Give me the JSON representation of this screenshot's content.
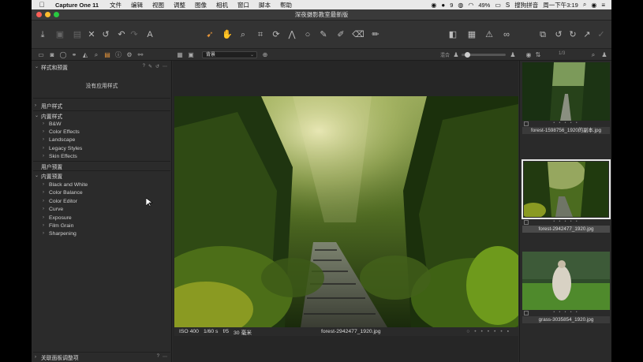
{
  "menubar": {
    "app_name": "Capture One 11",
    "items": [
      "文件",
      "编辑",
      "视图",
      "调整",
      "图像",
      "相机",
      "窗口",
      "脚本",
      "帮助"
    ],
    "status": {
      "notif_count": "9",
      "battery": "49%",
      "input_method": "搜狗拼音",
      "clock": "周一下午3:19"
    }
  },
  "window": {
    "title": "深夜摄影教室最新版"
  },
  "subbar": {
    "layer": "背景",
    "mix_label": "混合",
    "counter": "1/3"
  },
  "left_panel": {
    "styles_header": "样式和预置",
    "no_styles": "没有应用样式",
    "user_styles": "用户样式",
    "builtin_styles": "内置样式",
    "style_items": [
      "B&W",
      "Color Effects",
      "Landscape",
      "Legacy Styles",
      "Skin Effects"
    ],
    "user_presets": "用户预置",
    "builtin_presets": "内置预置",
    "preset_items": [
      "Black and White",
      "Color Balance",
      "Color Editor",
      "Curve",
      "Exposure",
      "Film Grain",
      "Sharpening"
    ],
    "footer": "关联面板调整项"
  },
  "viewer": {
    "iso": "ISO 400",
    "shutter": "1/60 s",
    "aperture": "f/5",
    "focal": "30 毫米",
    "filename": "forest-2942477_1920.jpg"
  },
  "browser": {
    "thumbs": [
      {
        "caption": "forest-1598756_1920的副本.jpg"
      },
      {
        "caption": "forest-2942477_1920.jpg"
      },
      {
        "caption": "grass-3035854_1920.jpg"
      }
    ]
  },
  "colors": {
    "accent": "#e8963a",
    "panel_bg": "#2b2b2b"
  }
}
